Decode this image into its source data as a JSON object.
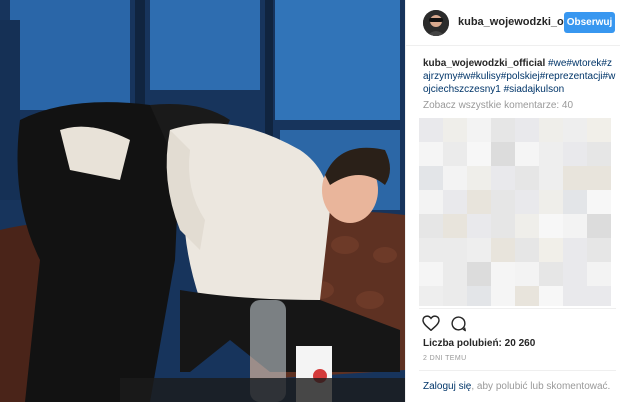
{
  "post": {
    "username": "kuba_wojewodzki_off",
    "follow_label": "Obserwuj",
    "caption_user": "kuba_wojewodzki_official",
    "caption_tags": "#we#wtorek#zajrzymy#w#kulisy#polskiej#reprezentacji#wojciechszczesny1 #siadajkulson",
    "view_all_comments": "Zobacz wszystkie komentarze: 40",
    "likes": "Liczba polubień: 20 260",
    "time_ago": "2 DNI TEMU",
    "login_link": "Zaloguj się",
    "login_rest": ", aby polubić lub skomentować."
  },
  "photo": {
    "description_colors": {
      "background": "#1b3a63",
      "panel": "#2f6fb5",
      "sofa": "#5a2f20",
      "sweater": "#ece7df",
      "suit": "#161616"
    }
  },
  "colors": {
    "accent": "#3897f0",
    "link": "#003569",
    "muted": "#999999",
    "text": "#262626"
  },
  "icons": [
    "heart-icon",
    "comment-icon"
  ]
}
